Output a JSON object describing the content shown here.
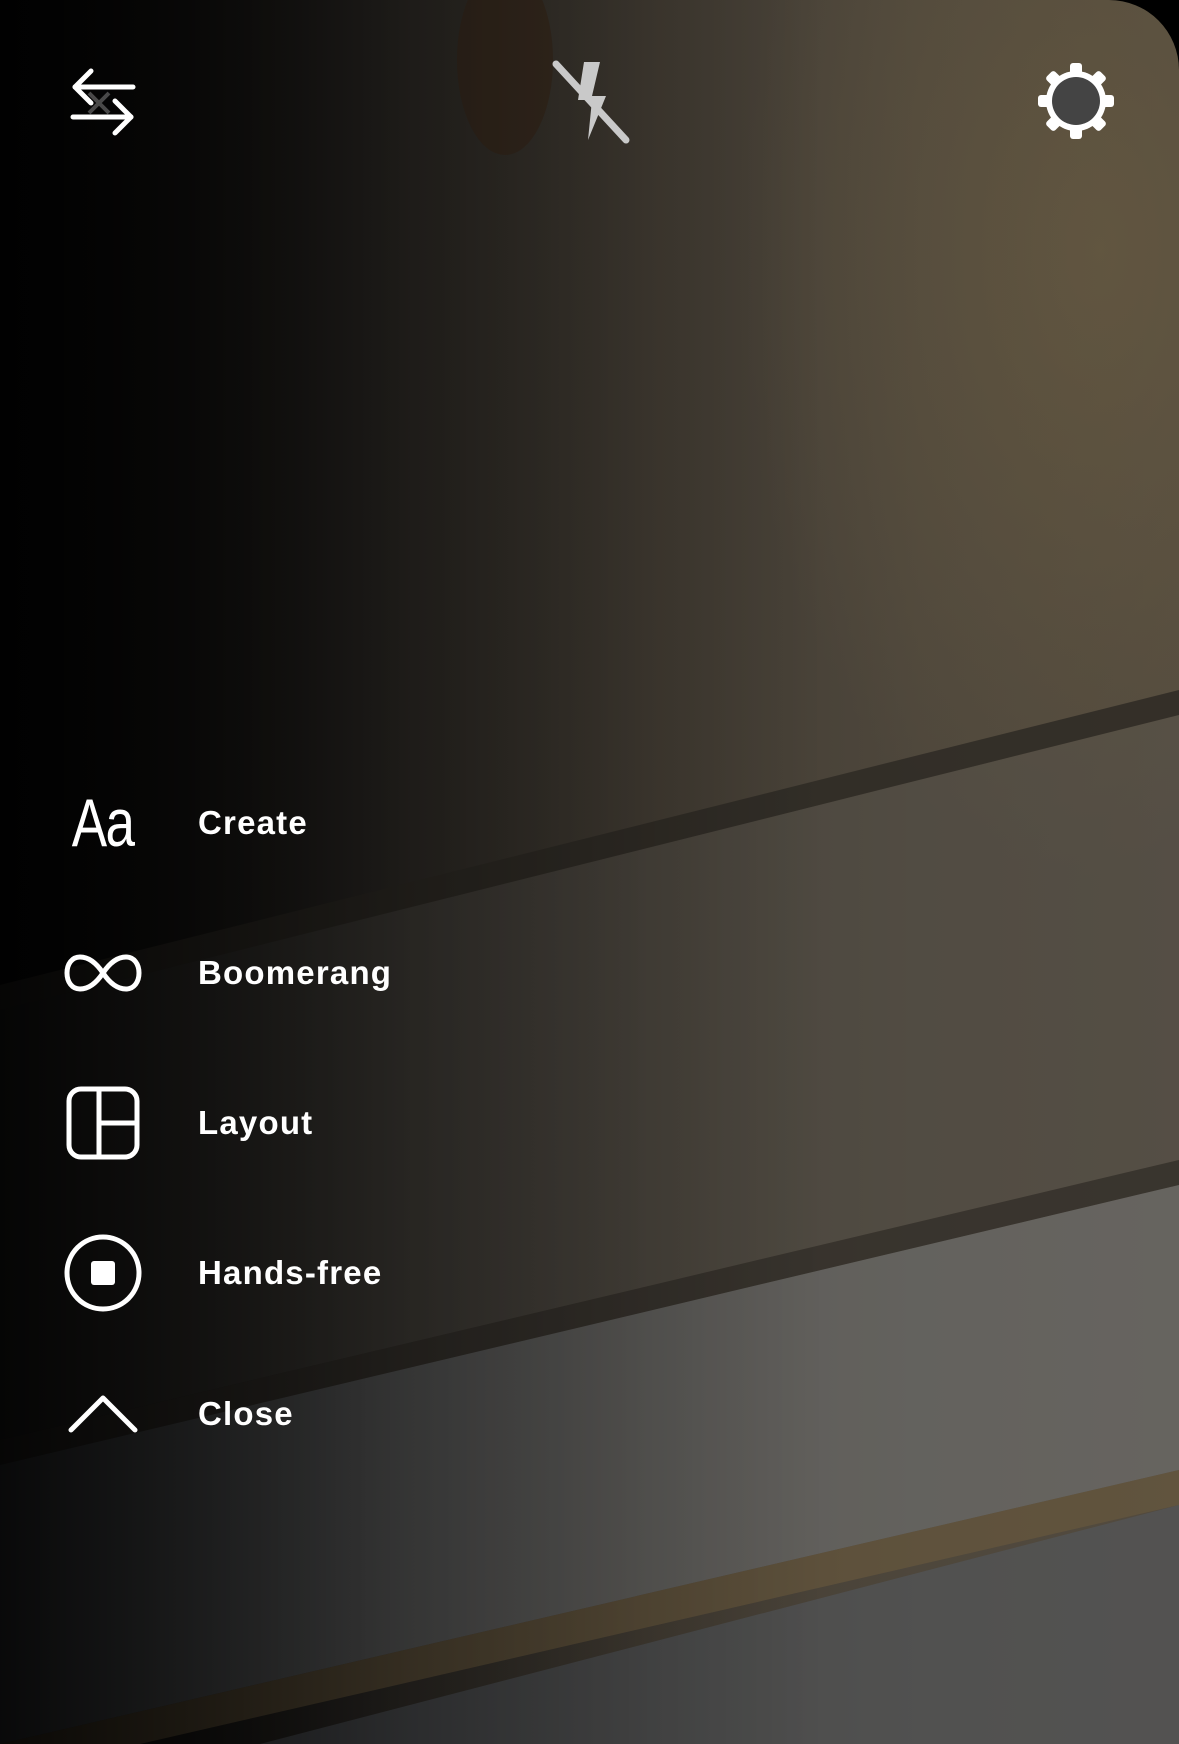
{
  "app": {
    "screen": "camera"
  },
  "toolbar": {
    "flip_icon": "flip-camera-icon",
    "flash_icon": "flash-off-icon",
    "settings_icon": "gear-icon"
  },
  "menu": {
    "items": [
      {
        "label": "Create",
        "icon": "text-aa-icon",
        "icon_text": "Aa"
      },
      {
        "label": "Boomerang",
        "icon": "infinity-icon"
      },
      {
        "label": "Layout",
        "icon": "layout-grid-icon"
      },
      {
        "label": "Hands-free",
        "icon": "record-stop-icon"
      },
      {
        "label": "Close",
        "icon": "chevron-up-icon"
      }
    ]
  },
  "colors": {
    "icon": "#ffffff",
    "label": "#ffffff",
    "flash_icon": "#c9c9c9"
  }
}
